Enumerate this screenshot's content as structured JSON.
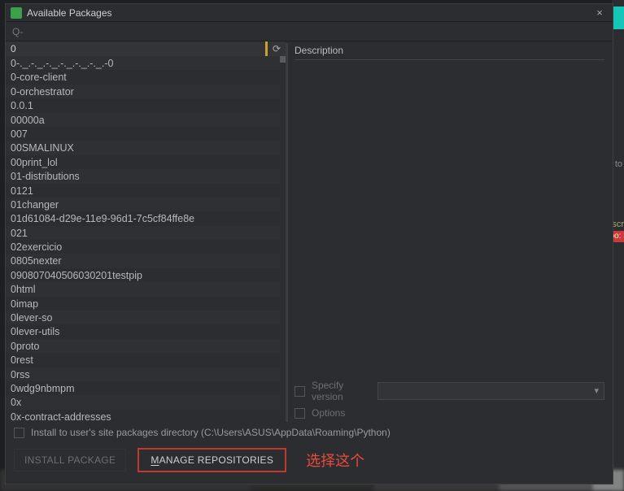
{
  "window": {
    "title": "Available Packages"
  },
  "search": {
    "placeholder": ""
  },
  "packages": {
    "selected": "0",
    "items": [
      "0-._.-._.-._.-._.-._.-._.-0",
      "0-core-client",
      "0-orchestrator",
      "0.0.1",
      "00000a",
      "007",
      "00SMALINUX",
      "00print_lol",
      "01-distributions",
      "0121",
      "01changer",
      "01d61084-d29e-11e9-96d1-7c5cf84ffe8e",
      "021",
      "02exercicio",
      "0805nexter",
      "090807040506030201testpip",
      "0html",
      "0imap",
      "0lever-so",
      "0lever-utils",
      "0proto",
      "0rest",
      "0rss",
      "0wdg9nbmpm",
      "0x",
      "0x-contract-addresses"
    ]
  },
  "details": {
    "description_label": "Description",
    "specify_version_label": "Specify version",
    "options_label": "Options"
  },
  "footer": {
    "install_to_user_label": "Install to user's site packages directory (C:\\Users\\ASUS\\AppData\\Roaming\\Python)",
    "install_button": "INSTALL PACKAGE",
    "manage_button_prefix": "M",
    "manage_button_rest": "ANAGE REPOSITORIES",
    "annotation": "选择这个"
  },
  "backdrop": {
    "side_to": ", to",
    "side_scr": "scr",
    "side_badge": "kpo:"
  }
}
